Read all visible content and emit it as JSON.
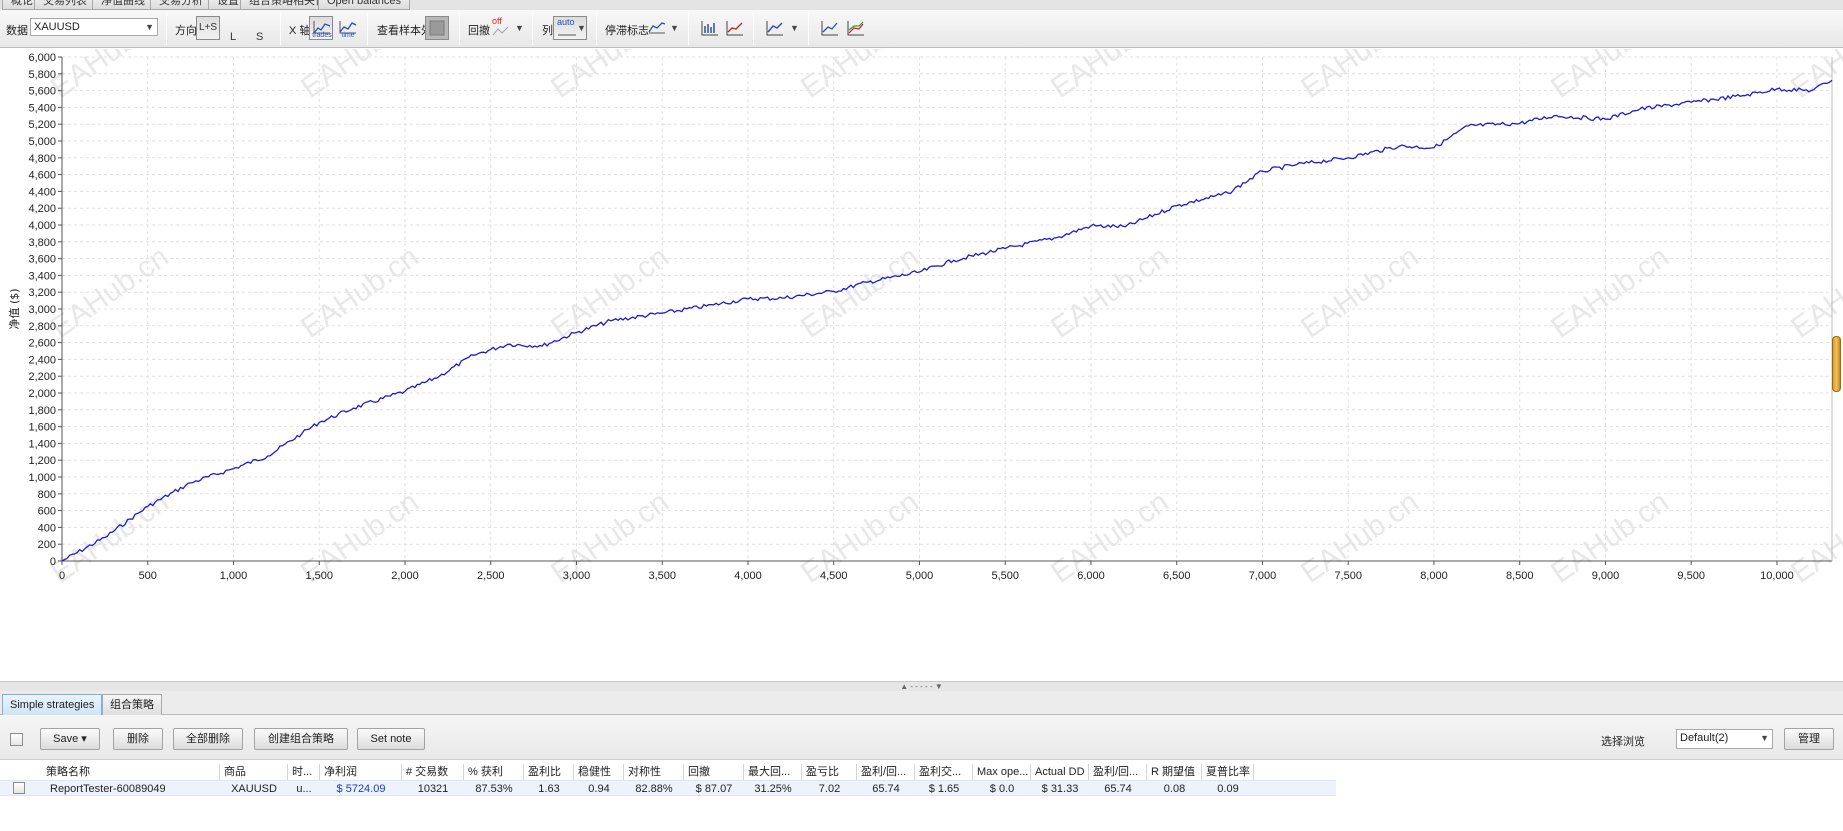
{
  "top_tabs": [
    "概论",
    "交易列表",
    "净值曲线",
    "交易分析",
    "设置",
    "组合策略相关性",
    "Open balances"
  ],
  "toolbar": {
    "data_label": "数据",
    "data_select": "XAUUSD",
    "direction_label": "方向",
    "direction_options": [
      "L+S",
      "L",
      "S"
    ],
    "xaxis_label": "X 轴",
    "xaxis_buttons": [
      {
        "caption": "trades",
        "icon": "trades-axis-icon"
      },
      {
        "caption": "time",
        "icon": "time-axis-icon"
      }
    ],
    "oos_label": "查看样本外",
    "drawdown_label": "回撤",
    "drawdown_toggle": "off",
    "columns_label": "列",
    "columns_toggle": "auto",
    "stagnation_label": "停滞标志"
  },
  "chart_data": {
    "type": "line",
    "title": "",
    "xlabel": "",
    "ylabel": "净值 ($)",
    "xlim": [
      0,
      10321
    ],
    "ylim": [
      0,
      6000
    ],
    "x_ticks": [
      "0",
      "500",
      "1,000",
      "1,500",
      "2,000",
      "2,500",
      "3,000",
      "3,500",
      "4,000",
      "4,500",
      "5,000",
      "5,500",
      "6,000",
      "6,500",
      "7,000",
      "7,500",
      "8,000",
      "8,500",
      "9,000",
      "9,500",
      "10,000"
    ],
    "y_ticks": [
      "0",
      "200",
      "400",
      "600",
      "800",
      "1,000",
      "1,200",
      "1,400",
      "1,600",
      "1,800",
      "2,000",
      "2,200",
      "2,400",
      "2,600",
      "2,800",
      "3,000",
      "3,200",
      "3,400",
      "3,600",
      "3,800",
      "4,000",
      "4,200",
      "4,400",
      "4,600",
      "4,800",
      "5,000",
      "5,200",
      "5,400",
      "5,600",
      "5,800",
      "6,000"
    ],
    "grid": true,
    "series": [
      {
        "color": "#1c1ccc",
        "x": [
          0,
          250,
          500,
          750,
          1000,
          1200,
          1400,
          1500,
          1700,
          2000,
          2200,
          2400,
          2600,
          2800,
          3000,
          3200,
          3500,
          3800,
          4000,
          4200,
          4500,
          4700,
          5000,
          5200,
          5500,
          5800,
          6000,
          6200,
          6500,
          6800,
          7000,
          7200,
          7500,
          7800,
          8000,
          8200,
          8500,
          8700,
          9000,
          9200,
          9500,
          9800,
          10000,
          10200,
          10321
        ],
        "y": [
          0,
          280,
          650,
          930,
          1100,
          1250,
          1520,
          1650,
          1820,
          2020,
          2200,
          2450,
          2580,
          2560,
          2720,
          2860,
          2950,
          3050,
          3120,
          3130,
          3210,
          3320,
          3440,
          3580,
          3720,
          3850,
          3990,
          3980,
          4230,
          4380,
          4640,
          4720,
          4800,
          4940,
          4920,
          5180,
          5210,
          5300,
          5260,
          5380,
          5460,
          5540,
          5620,
          5600,
          5724
        ]
      }
    ]
  },
  "watermark": "EAHub.cn",
  "lower_tabs": [
    "Simple strategies",
    "组合策略"
  ],
  "actions": {
    "save": "Save ▾",
    "delete": "删除",
    "delete_all": "全部删除",
    "create_portfolio": "创建组合策略",
    "set_note": "Set note",
    "select_view_label": "选择浏览",
    "view_select": "Default(2)",
    "manage": "管理"
  },
  "table": {
    "headers": [
      "策略名称",
      "商品",
      "时...",
      "净利润",
      "# 交易数",
      "% 获利",
      "盈利比",
      "稳健性",
      "对称性",
      "回撤",
      "最大回...",
      "盈亏比",
      "盈利/回...",
      "盈利交...",
      "Max ope...",
      "Actual DD",
      "盈利/回...",
      "R 期望值",
      "夏普比率"
    ],
    "rows": [
      [
        "ReportTester-60089049",
        "XAUUSD",
        "u...",
        "$ 5724.09",
        "10321",
        "87.53%",
        "1.63",
        "0.94",
        "82.88%",
        "$ 87.07",
        "31.25%",
        "7.02",
        "65.74",
        "$ 1.65",
        "$ 0.0",
        "$ 31.33",
        "65.74",
        "0.08",
        "0.09"
      ]
    ]
  }
}
